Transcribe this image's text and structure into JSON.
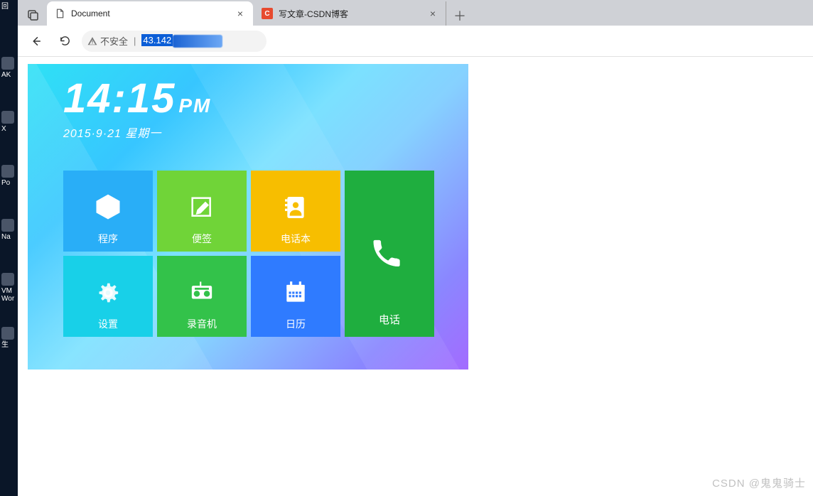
{
  "desktop_labels": {
    "back": "回",
    "ak": "AK",
    "x": "X",
    "po": "Po",
    "na": "Na",
    "vm": "VM\nWor",
    "last": "生"
  },
  "tabs": {
    "active": {
      "title": "Document"
    },
    "inactive": {
      "title": "写文章-CSDN博客"
    }
  },
  "address": {
    "insecure_label": "不安全",
    "url_shown": "43.142"
  },
  "launcher": {
    "clock_time": "14:15",
    "clock_ampm": "PM",
    "date_line": "2015·9·21  星期一",
    "tiles": {
      "programs": "程序",
      "notes": "便签",
      "contacts": "电话本",
      "settings": "设置",
      "recorder": "录音机",
      "calendar": "日历",
      "phone": "电话"
    }
  },
  "watermark": "CSDN @鬼鬼骑士"
}
